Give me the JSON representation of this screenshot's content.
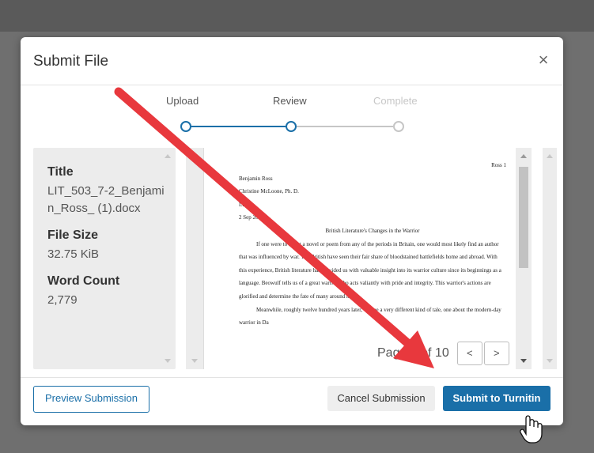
{
  "modal": {
    "title": "Submit File",
    "close_glyph": "×"
  },
  "steps": [
    {
      "label": "Upload",
      "state": "done"
    },
    {
      "label": "Review",
      "state": "current"
    },
    {
      "label": "Complete",
      "state": "pending"
    }
  ],
  "file_info": {
    "title_label": "Title",
    "title_value": "LIT_503_7-2_Benjamin_Ross_ (1).docx",
    "size_label": "File Size",
    "size_value": "32.75 KiB",
    "words_label": "Word Count",
    "words_value": "2,779"
  },
  "document": {
    "page_header": "Ross 1",
    "lines": [
      "Benjamin Ross",
      "Christine McLoone, Ph. D.",
      "LIT",
      "2 Sep 2019"
    ],
    "heading": "British Literature's Changes in the Warrior",
    "paragraphs": [
      "If one were to select a novel or poem from any of the periods in Britain, one would most likely find an author that was influenced by war. The British have seen their fair share of bloodstained battlefields home and abroad. With this experience, British literature has provided us with valuable insight into its warrior culture since its beginnings as a language. Beowulf tells us of a great warrior who acts valiantly with pride and integrity. This warrior's actions are glorified and determine the fate of many around him.",
      "Meanwhile, roughly twelve hundred years later, we see a very different kind of tale, one about the modern-day warrior in Da"
    ]
  },
  "pager": {
    "text": "Page 1 of 10",
    "prev": "<",
    "next": ">"
  },
  "buttons": {
    "preview": "Preview Submission",
    "cancel": "Cancel Submission",
    "submit": "Submit to Turnitin"
  },
  "colors": {
    "accent": "#1a6fa8",
    "annotation_arrow": "#e8383d"
  },
  "icons": {
    "close": "close-icon",
    "cursor": "hand-cursor-icon"
  }
}
